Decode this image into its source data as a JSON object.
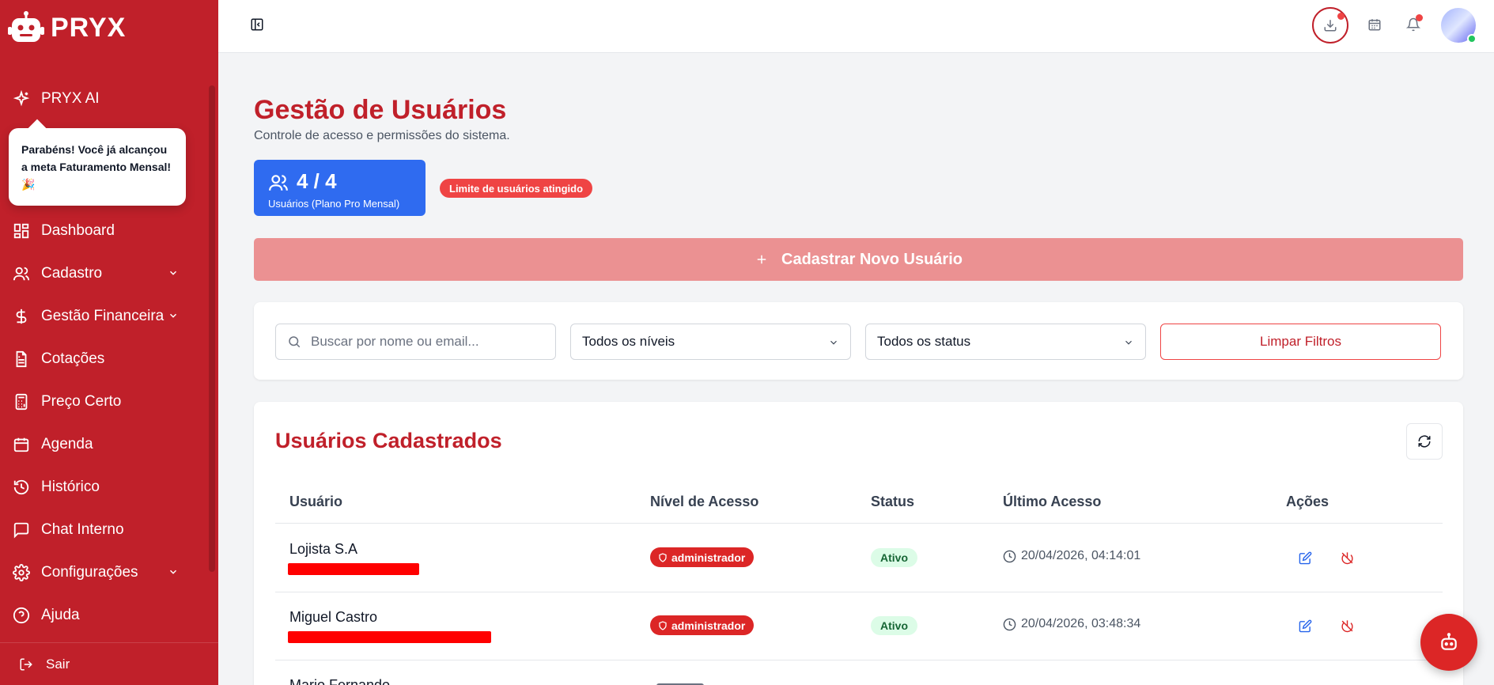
{
  "brand": {
    "name": "PRYX"
  },
  "sidebar": {
    "ai_label": "PRYX AI",
    "toast": "Parabéns! Você já alcançou a meta Faturamento Mensal! 🎉",
    "items": [
      {
        "label": "Dashboard",
        "icon": "dashboard-icon"
      },
      {
        "label": "Cadastro",
        "icon": "users-icon",
        "has_submenu": true
      },
      {
        "label": "Gestão Financeira",
        "icon": "dollar-icon",
        "has_submenu": true
      },
      {
        "label": "Cotações",
        "icon": "file-text-icon"
      },
      {
        "label": "Preço Certo",
        "icon": "calculator-icon"
      },
      {
        "label": "Agenda",
        "icon": "calendar-icon"
      },
      {
        "label": "Histórico",
        "icon": "history-icon"
      },
      {
        "label": "Chat Interno",
        "icon": "chat-icon"
      },
      {
        "label": "Configurações",
        "icon": "gear-icon",
        "has_submenu": true
      },
      {
        "label": "Ajuda",
        "icon": "help-icon"
      }
    ],
    "logout_label": "Sair"
  },
  "header": {
    "icons": [
      "sidebar-toggle-icon",
      "download-icon",
      "calendar-icon",
      "bell-icon",
      "avatar"
    ]
  },
  "page": {
    "title": "Gestão de Usuários",
    "subtitle": "Controle de acesso e permissões do sistema.",
    "usage": {
      "count": "4 / 4",
      "label": "Usuários (Plano Pro Mensal)"
    },
    "limit_badge": "Limite de usuários atingido",
    "add_button": "Cadastrar Novo Usuário"
  },
  "filters": {
    "search_placeholder": "Buscar por nome ou email...",
    "level_select": "Todos os níveis",
    "status_select": "Todos os status",
    "clear_button": "Limpar Filtros"
  },
  "users": {
    "title": "Usuários Cadastrados",
    "columns": [
      "Usuário",
      "Nível de Acesso",
      "Status",
      "Último Acesso",
      "Ações"
    ],
    "rows": [
      {
        "name": "Lojista S.A",
        "role": "administrador",
        "status": "Ativo",
        "last_access": "20/04/2026, 04:14:01"
      },
      {
        "name": "Miguel Castro",
        "role": "administrador",
        "status": "Ativo",
        "last_access": "20/04/2026, 03:48:34"
      },
      {
        "name": "Mario Fernando",
        "role": "",
        "status": "",
        "last_access": ""
      }
    ]
  },
  "colors": {
    "brand_red": "#c0202a",
    "primary_blue": "#2f6bf0",
    "status_green_bg": "#dcfce7"
  }
}
